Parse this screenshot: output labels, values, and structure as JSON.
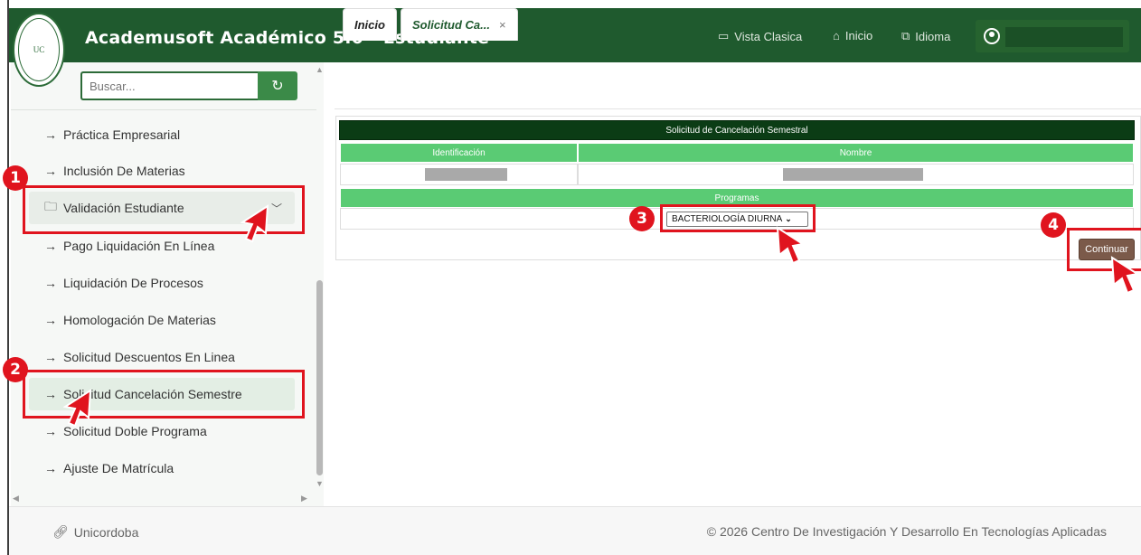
{
  "header": {
    "title": "Academusoft Académico 5.0 - Estudiante",
    "links": [
      {
        "label": "Vista Clasica",
        "icon": "window-icon"
      },
      {
        "label": "Inicio",
        "icon": "home-icon"
      },
      {
        "label": "Idioma",
        "icon": "translate-icon"
      }
    ]
  },
  "sidebar": {
    "search_placeholder": "Buscar...",
    "items": [
      {
        "label": "Práctica Empresarial"
      },
      {
        "label": "Inclusión De Materias"
      },
      {
        "label": "Validación Estudiante",
        "folder": true
      },
      {
        "label": "Pago Liquidación En Línea"
      },
      {
        "label": "Liquidación De Procesos"
      },
      {
        "label": "Homologación De Materias"
      },
      {
        "label": "Solicitud Descuentos En Linea"
      },
      {
        "label": "Solicitud Cancelación Semestre",
        "active": true
      },
      {
        "label": "Solicitud Doble Programa"
      },
      {
        "label": "Ajuste De Matrícula"
      }
    ]
  },
  "tabs": [
    {
      "label": "Inicio"
    },
    {
      "label": "Solicitud Ca...",
      "close": "×"
    }
  ],
  "form": {
    "title": "Solicitud de Cancelación Semestral",
    "col_id": "Identificación",
    "col_name": "Nombre",
    "programs_label": "Programas",
    "program_selected": "BACTERIOLOGÍA DIURNA",
    "continue_label": "Continuar"
  },
  "annotations": {
    "step1": "1",
    "step2": "2",
    "step3": "3",
    "step4": "4"
  },
  "footer": {
    "left": "Unicordoba",
    "right": "© 2026 Centro De Investigación Y Desarrollo En Tecnologías Aplicadas"
  },
  "colors": {
    "header_bg": "#1f5a2e",
    "table_header": "#5acb74",
    "form_title_bg": "#0b3c15",
    "annotation_red": "#e0141e",
    "continue_btn": "#7b5a4a"
  }
}
